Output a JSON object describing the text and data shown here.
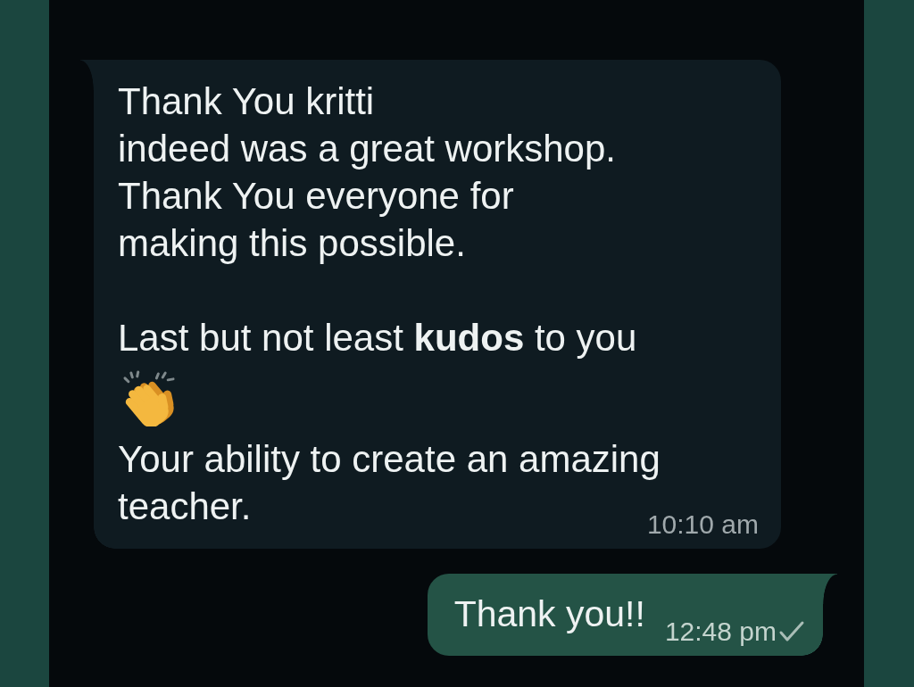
{
  "messages": [
    {
      "kind": "incoming",
      "blocks": [
        {
          "kind": "text",
          "text": "Thank You kritti\nindeed was a great workshop.\nThank You everyone for\nmaking this possible.\n\nLast but not least **kudos** to you"
        },
        {
          "kind": "clap"
        },
        {
          "kind": "text",
          "text": "Your ability to create an amazing\nteacher."
        }
      ],
      "time": "10:10 am"
    },
    {
      "kind": "outgoing",
      "blocks": [
        {
          "kind": "text",
          "text": "Thank you!!"
        }
      ],
      "time": "12:48 pm",
      "sent": true
    }
  ]
}
